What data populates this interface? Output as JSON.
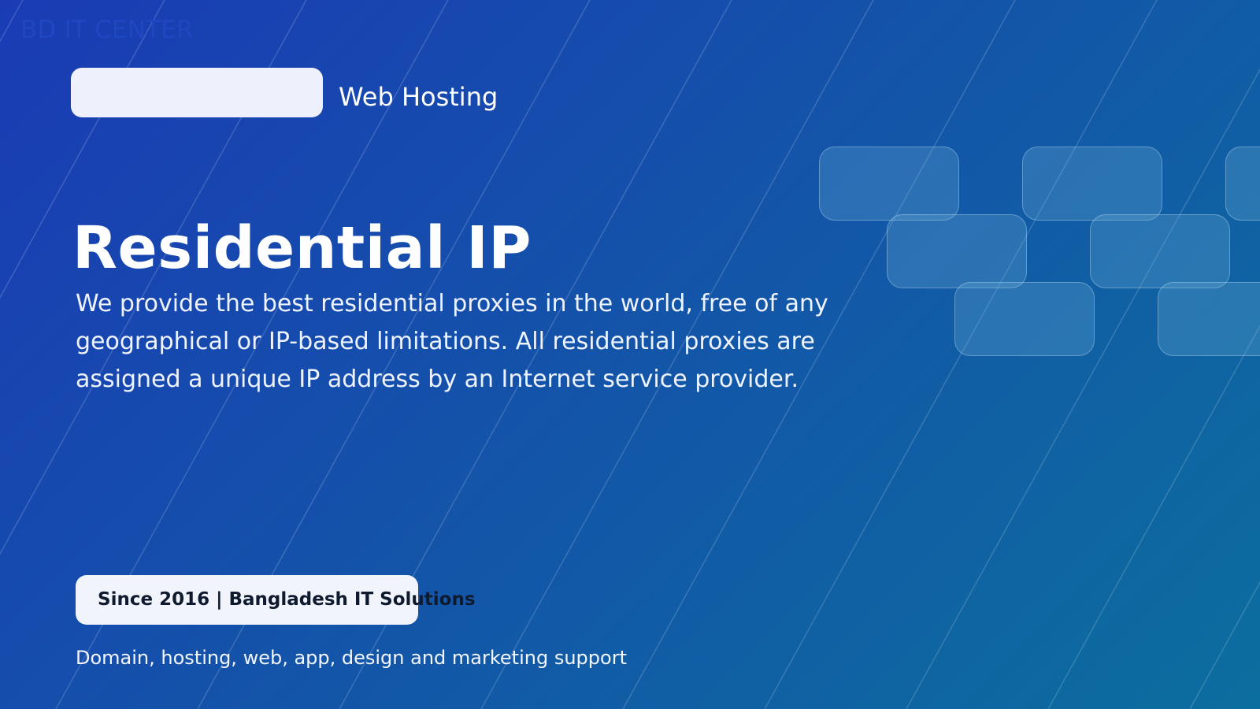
{
  "brand": {
    "name": "BD IT CENTER",
    "category": "Web Hosting"
  },
  "hero": {
    "title": "Residential IP",
    "description": "We provide the best residential proxies in the world, free of any geographical or IP-based limitations. All residential proxies are assigned a unique IP address by an Internet service provider."
  },
  "footer": {
    "since_badge": "Since 2016 | Bangladesh IT Solutions",
    "tagline": "Domain, hosting, web, app, design and marketing support"
  },
  "colors": {
    "gradient_start": "#1a3bb5",
    "gradient_mid": "#1452aa",
    "gradient_end": "#0c6e9e",
    "brand_text": "#1f47c2",
    "badge_background": "#eef1fb"
  }
}
